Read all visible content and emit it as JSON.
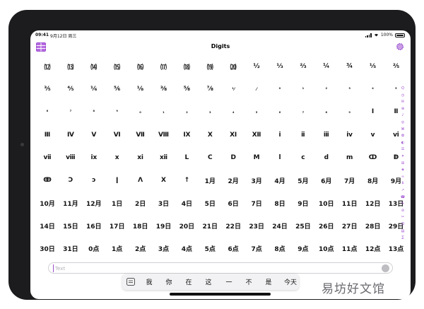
{
  "status": {
    "time": "09:41",
    "date": "9月12日 周三",
    "battery": "100%"
  },
  "nav": {
    "title": "Digits"
  },
  "keys": [
    [
      "⑿",
      "⒀",
      "⒁",
      "⒂",
      "⒃",
      "⒄",
      "⒅",
      "⒆",
      "⒇",
      "½",
      "⅓",
      "⅔",
      "¼",
      "¾",
      "⅕",
      "⅖"
    ],
    [
      "⅗",
      "⅘",
      "⅙",
      "⅚",
      "⅛",
      "⅜",
      "⅝",
      "⅞",
      "⅟",
      "⁄",
      "⁰",
      "¹",
      "²",
      "³",
      "⁴",
      "⁵"
    ],
    [
      "⁶",
      "⁷",
      "⁸",
      "⁹",
      "₀",
      "₁",
      "₂",
      "₃",
      "₄",
      "₅",
      "₆",
      "₇",
      "₈",
      "₉",
      "Ⅰ",
      "Ⅱ"
    ],
    [
      "Ⅲ",
      "Ⅳ",
      "Ⅴ",
      "Ⅵ",
      "Ⅶ",
      "Ⅷ",
      "Ⅸ",
      "Ⅹ",
      "Ⅺ",
      "Ⅻ",
      "ⅰ",
      "ⅱ",
      "ⅲ",
      "ⅳ",
      "ⅴ",
      "ⅵ"
    ],
    [
      "ⅶ",
      "ⅷ",
      "ⅸ",
      "ⅹ",
      "ⅺ",
      "ⅻ",
      "Ⅼ",
      "Ⅽ",
      "Ⅾ",
      "Ⅿ",
      "ⅼ",
      "ⅽ",
      "ⅾ",
      "ⅿ",
      "ↀ",
      "ↁ"
    ],
    [
      "ↂ",
      "Ↄ",
      "ↄ",
      "ǀ",
      "Λ",
      "Χ",
      "↑",
      "1月",
      "2月",
      "3月",
      "4月",
      "5月",
      "6月",
      "7月",
      "8月",
      "9月"
    ],
    [
      "10月",
      "11月",
      "12月",
      "1日",
      "2日",
      "3日",
      "4日",
      "5日",
      "6日",
      "7日",
      "8日",
      "9日",
      "10日",
      "11日",
      "12日",
      "13日"
    ],
    [
      "14日",
      "15日",
      "16日",
      "17日",
      "18日",
      "19日",
      "20日",
      "21日",
      "22日",
      "23日",
      "24日",
      "25日",
      "26日",
      "27日",
      "28日",
      "29日"
    ],
    [
      "30日",
      "31日",
      "0点",
      "1点",
      "2点",
      "3点",
      "4点",
      "5点",
      "6点",
      "7点",
      "8点",
      "9点",
      "10点",
      "11点",
      "12点",
      "13点"
    ]
  ],
  "index": [
    "Q",
    "◷",
    "✉",
    "⊕",
    "♪",
    "◎",
    "⌘",
    "✿",
    "◐",
    "☰",
    "✦",
    "⊞",
    "◈",
    "∞",
    "$",
    "↗",
    "☎",
    "✎",
    "⊘",
    "✂",
    "Ω",
    "▤",
    "∑"
  ],
  "input": {
    "placeholder": "Text"
  },
  "candidates": [
    "我",
    "你",
    "在",
    "这",
    "一",
    "不",
    "是",
    "今天"
  ],
  "watermark": "易坊好文馆",
  "colors": {
    "accent": "#9b4dd0",
    "device": "#1c1c1e"
  }
}
